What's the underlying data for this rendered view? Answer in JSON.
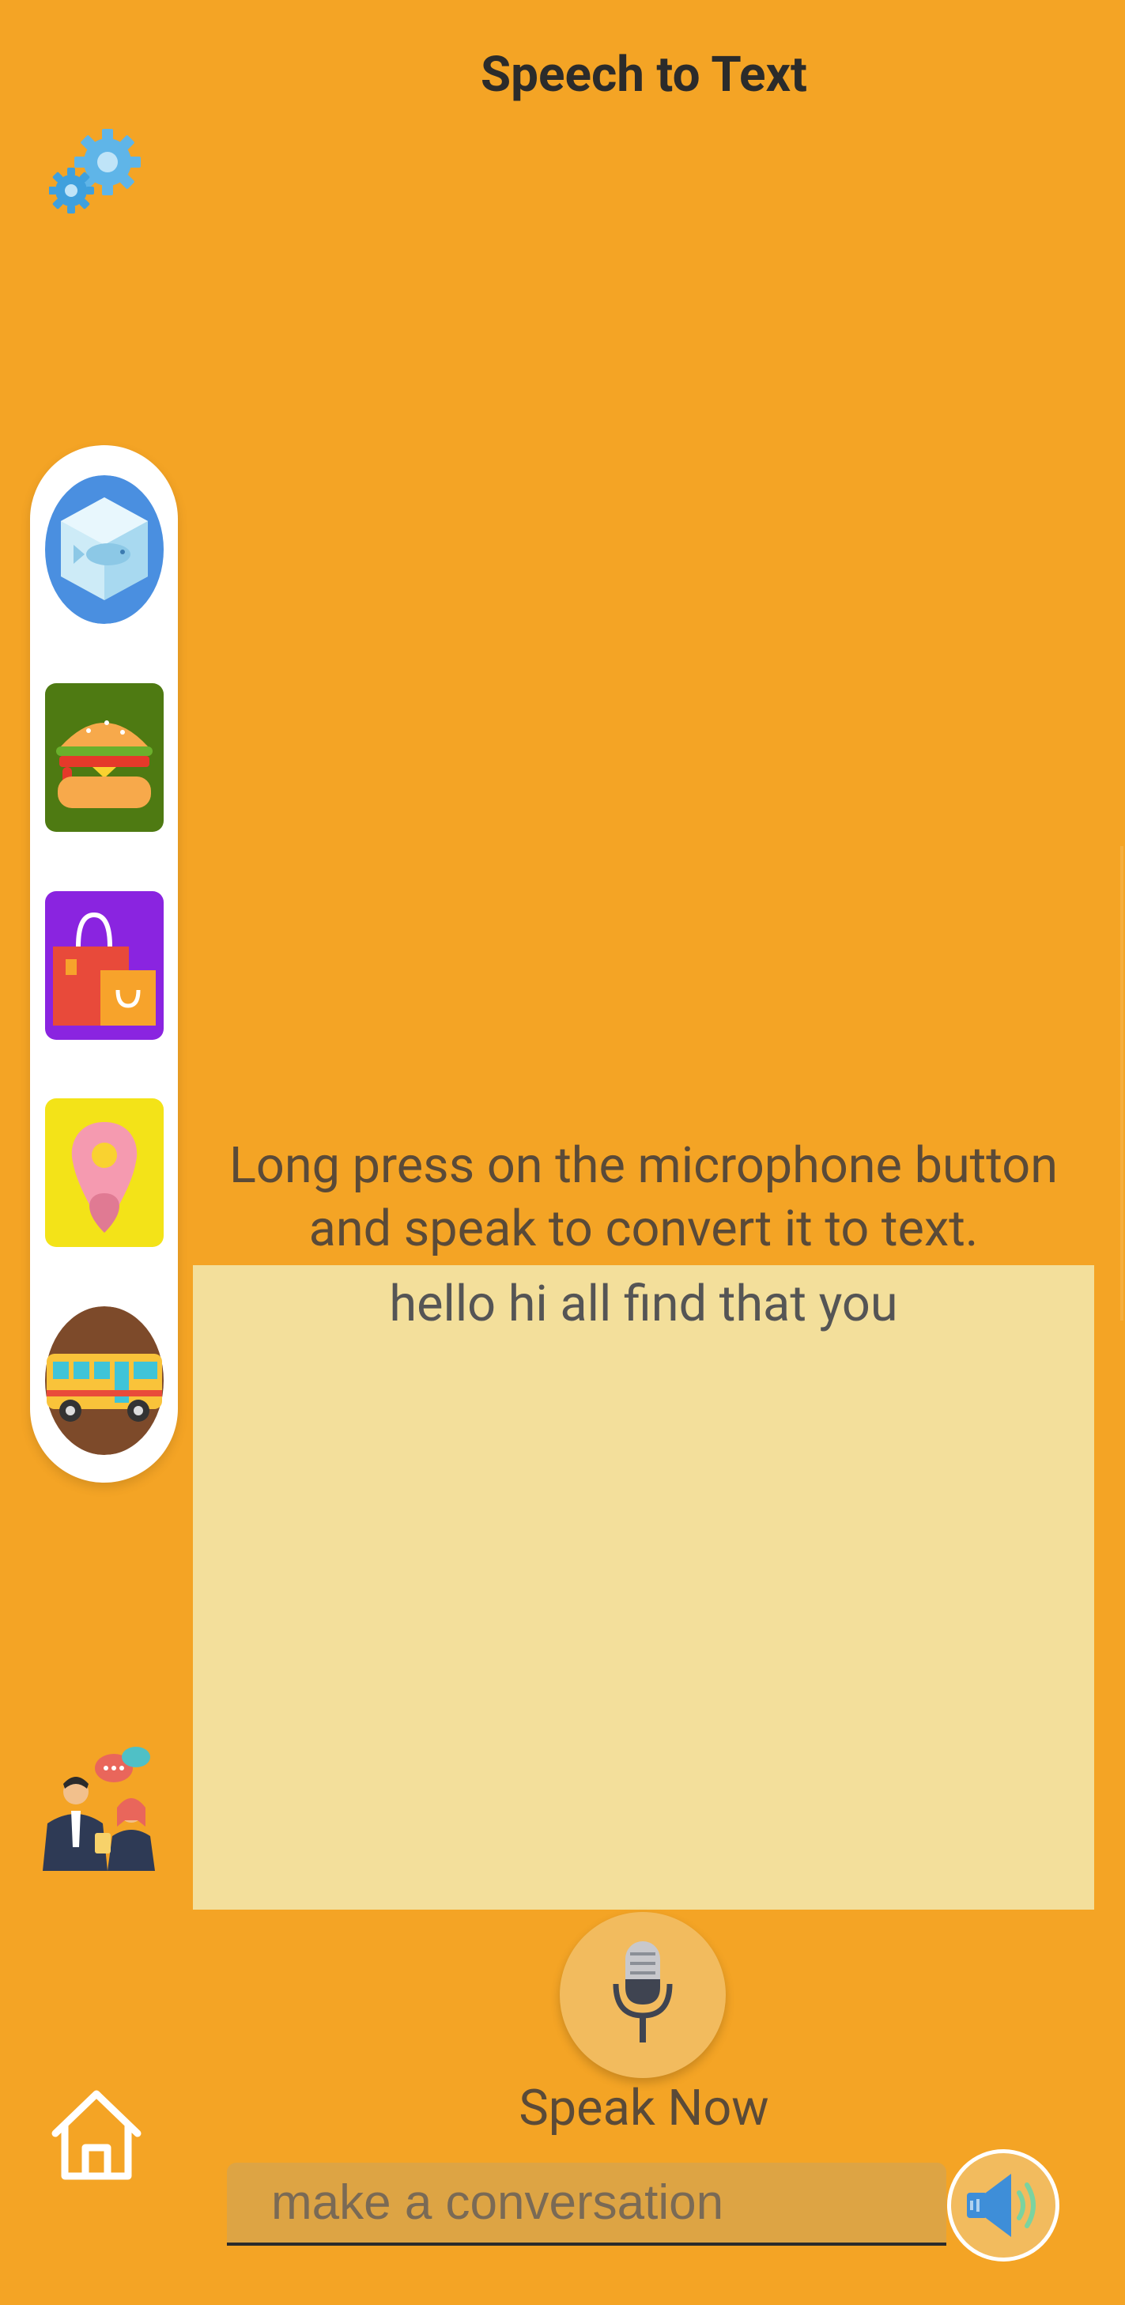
{
  "header": {
    "title": "Speech to Text"
  },
  "icons": {
    "settings": "gears-icon",
    "home": "home-icon",
    "microphone": "microphone-icon",
    "speaker": "speaker-icon",
    "chat_people": "chat-people-icon"
  },
  "sidebar": {
    "items": [
      {
        "name": "frozen-fish-icon"
      },
      {
        "name": "burger-icon"
      },
      {
        "name": "shopping-bags-icon"
      },
      {
        "name": "map-pin-icon"
      },
      {
        "name": "school-bus-icon"
      }
    ]
  },
  "main": {
    "instruction": "Long press on the microphone button and speak to convert it to text.",
    "transcript": "hello hi all find that you",
    "speak_label": "Speak Now"
  },
  "conversation": {
    "placeholder": "make a conversation"
  },
  "colors": {
    "background": "#F4A425",
    "text_area": "#F3DF9B",
    "input_bg": "#DDA444",
    "mic_button": "#F2BB5E"
  }
}
